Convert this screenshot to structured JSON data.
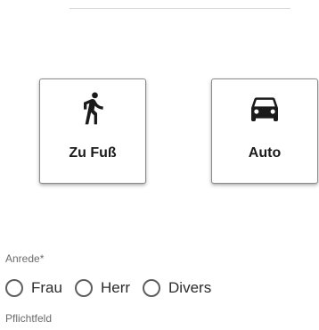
{
  "transport": {
    "options": [
      {
        "label": "Zu Fuß",
        "icon": "pedestrian-icon"
      },
      {
        "label": "Auto",
        "icon": "car-icon"
      }
    ]
  },
  "salutation": {
    "label": "Anrede*",
    "options": [
      "Frau",
      "Herr",
      "Divers"
    ],
    "selected": null,
    "helper": "Pflichtfeld"
  },
  "colors": {
    "card_border": "#8a8a8a",
    "radio_border": "#5f5f5f",
    "label_text": "#6b6b6b"
  }
}
